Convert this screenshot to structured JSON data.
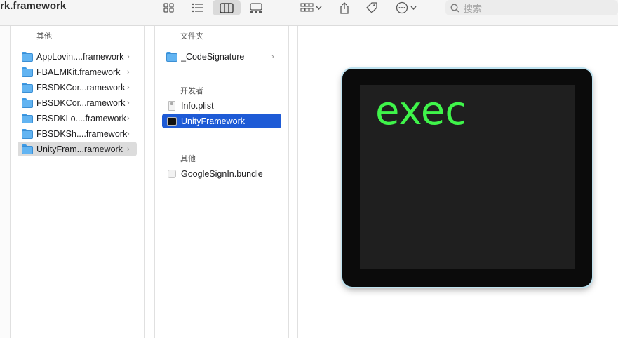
{
  "window": {
    "title": "rk.framework"
  },
  "toolbar": {
    "search_placeholder": "搜索"
  },
  "column1": {
    "section_label": "其他",
    "items": [
      {
        "label": "AppLovin....framework"
      },
      {
        "label": "FBAEMKit.framework"
      },
      {
        "label": "FBSDKCor...ramework"
      },
      {
        "label": "FBSDKCor...ramework"
      },
      {
        "label": "FBSDKLo....framework"
      },
      {
        "label": "FBSDKSh....framework"
      },
      {
        "label": "UnityFram...ramework"
      }
    ]
  },
  "column2": {
    "section_folders": "文件夹",
    "folder_item": "_CodeSignature",
    "section_developer": "开发者",
    "dev_items": [
      {
        "label": "Info.plist"
      },
      {
        "label": "UnityFramework"
      }
    ],
    "section_other": "其他",
    "other_item": "GoogleSignIn.bundle"
  },
  "preview": {
    "icon_text": "exec"
  },
  "colors": {
    "selection_blue": "#1e5bd6",
    "folder_blue": "#62b4f2",
    "terminal_green": "#3ff44a"
  }
}
